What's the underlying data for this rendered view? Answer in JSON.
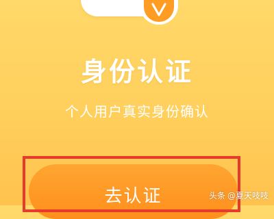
{
  "page": {
    "title": "身份认证",
    "subtitle": "个人用户真实身份确认",
    "action_button_label": "去认证"
  },
  "watermark": {
    "source": "头条",
    "account": "@夏天吱吱"
  },
  "colors": {
    "background": "#ffd36a",
    "button": "#ff951f",
    "highlight": "#e8392d",
    "badge": "#ff9c23"
  },
  "icons": {
    "hero_badge": "checkmark-icon"
  }
}
